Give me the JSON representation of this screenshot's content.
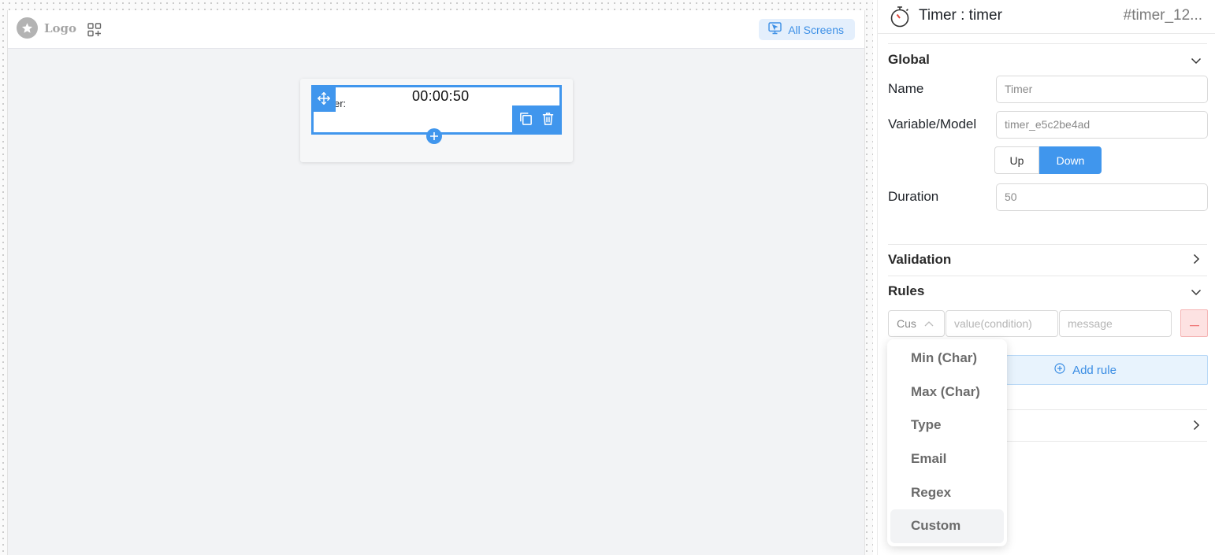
{
  "canvas": {
    "logo": {
      "text": "Logo",
      "icon": "star-icon"
    },
    "topbar": {
      "all_screens_label": "All Screens",
      "all_screens_icon": "screen-cursor-icon",
      "add_widget_icon": "grid-plus-icon"
    },
    "form": {
      "timer_label": "er:",
      "timer_value": "00:00:50",
      "move_icon": "move-arrows-icon",
      "copy_icon": "copy-icon",
      "delete_icon": "trash-icon",
      "add_icon": "plus-icon"
    }
  },
  "panel": {
    "title": "Timer : timer",
    "component_id": "#timer_12...",
    "title_icon": "stopwatch-icon",
    "sections": {
      "global": {
        "title": "Global"
      },
      "validation": {
        "title": "Validation"
      },
      "rules": {
        "title": "Rules"
      }
    },
    "fields": {
      "name": {
        "label": "Name",
        "value": "Timer"
      },
      "variable": {
        "label": "Variable/Model",
        "value": "timer_e5c2be4ad"
      },
      "direction": {
        "options": [
          "Up",
          "Down"
        ],
        "selected": "Down"
      },
      "duration": {
        "label": "Duration",
        "value": "50"
      }
    },
    "rules": {
      "type_value": "Cus",
      "condition_placeholder": "value(condition)",
      "message_placeholder": "message",
      "add_rule_label": "Add rule"
    },
    "rule_type_dropdown": {
      "options": [
        "Min (Char)",
        "Max (Char)",
        "Type",
        "Email",
        "Regex",
        "Custom"
      ],
      "highlighted": "Custom"
    }
  },
  "colors": {
    "accent": "#4096ed",
    "accent_light": "#e4effc",
    "danger_light": "#fde2e2",
    "canvas_bg": "#f2f3f5"
  }
}
